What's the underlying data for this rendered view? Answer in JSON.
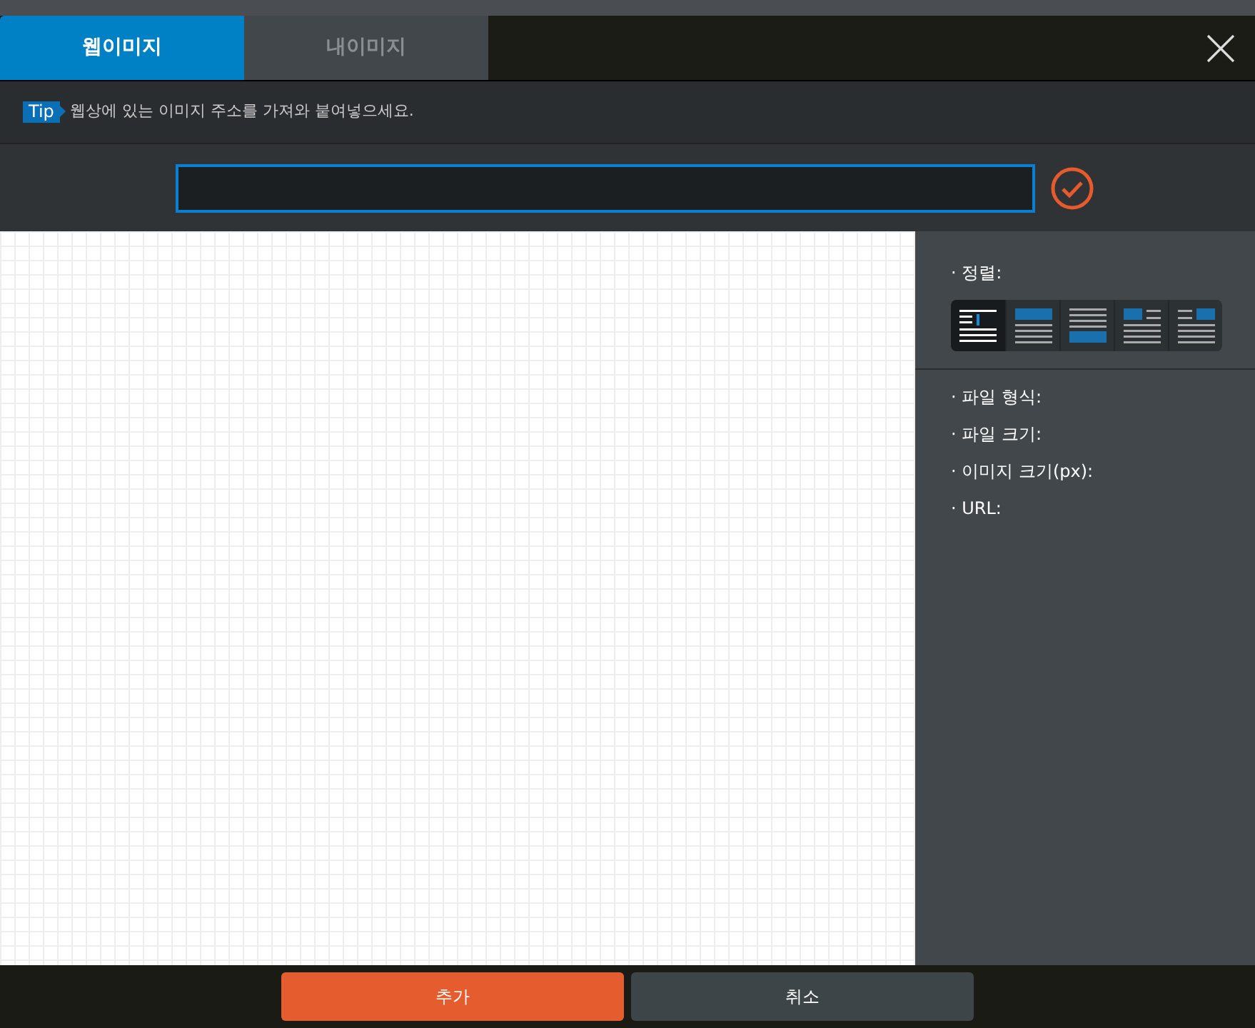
{
  "tabs": [
    {
      "label": "웹이미지",
      "selected": true
    },
    {
      "label": "내이미지",
      "selected": false
    }
  ],
  "tip": {
    "badge": "Tip",
    "text": "웹상에 있는 이미지 주소를 가져와 붙여넣으세요."
  },
  "side_panel": {
    "align_label": "· 정렬:",
    "align_options": [
      {
        "kind": "inline",
        "selected": true
      },
      {
        "kind": "top",
        "selected": false
      },
      {
        "kind": "bottom",
        "selected": false
      },
      {
        "kind": "left",
        "selected": false
      },
      {
        "kind": "right",
        "selected": false
      }
    ],
    "info": [
      "· 파일 형식:",
      "· 파일 크기:",
      "· 이미지 크기(px):",
      "· URL:"
    ]
  },
  "buttons": [
    {
      "label": "추가",
      "kind": "primary"
    },
    {
      "label": "취소",
      "kind": "secondary"
    }
  ]
}
